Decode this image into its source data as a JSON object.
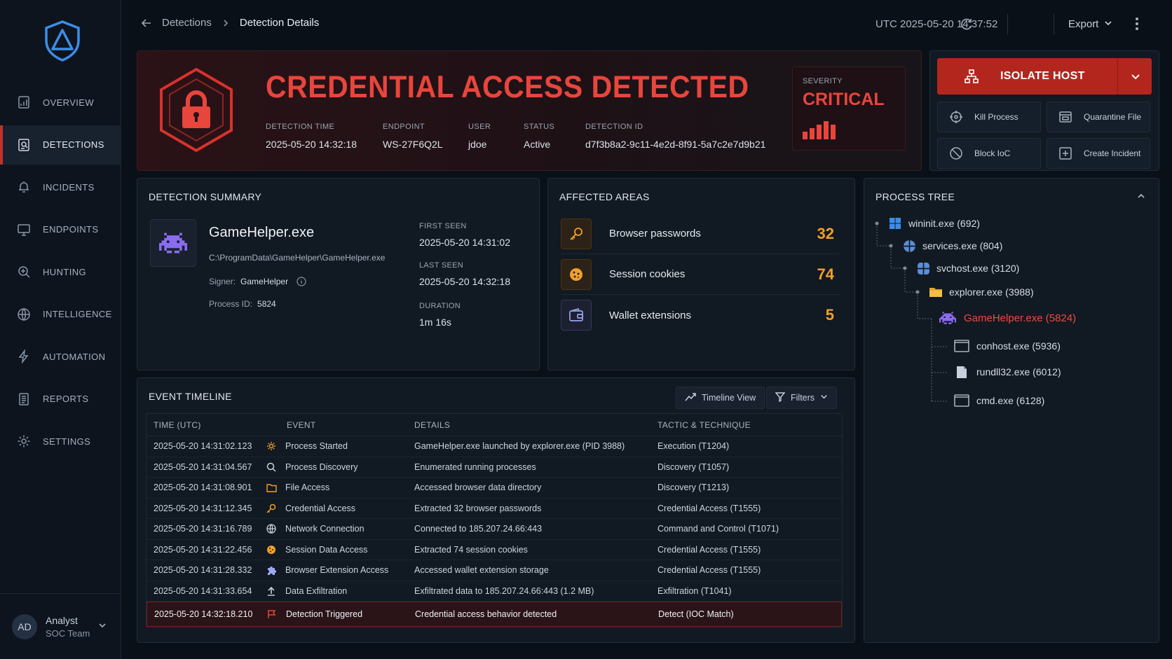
{
  "nav": {
    "items": [
      {
        "label": "OVERVIEW",
        "icon": "overview-icon"
      },
      {
        "label": "DETECTIONS",
        "icon": "detections-icon",
        "active": true
      },
      {
        "label": "INCIDENTS",
        "icon": "incidents-icon"
      },
      {
        "label": "ENDPOINTS",
        "icon": "endpoints-icon"
      },
      {
        "label": "HUNTING",
        "icon": "hunting-icon"
      },
      {
        "label": "INTELLIGENCE",
        "icon": "globe-icon"
      },
      {
        "label": "AUTOMATION",
        "icon": "automation-icon"
      },
      {
        "label": "REPORTS",
        "icon": "reports-icon"
      },
      {
        "label": "SETTINGS",
        "icon": "settings-icon"
      }
    ]
  },
  "user": {
    "initials": "AD",
    "name": "Analyst",
    "team": "SOC Team"
  },
  "topbar": {
    "breadcrumb_parent": "Detections",
    "breadcrumb_current": "Detection Details",
    "utc": "UTC 2025-05-20 14:37:52",
    "export_label": "Export"
  },
  "alert": {
    "title": "CREDENTIAL ACCESS DETECTED",
    "meta": [
      {
        "label": "DETECTION TIME",
        "value": "2025-05-20 14:32:18"
      },
      {
        "label": "ENDPOINT",
        "value": "WS-27F6Q2L"
      },
      {
        "label": "USER",
        "value": "jdoe"
      },
      {
        "label": "STATUS",
        "value": "Active"
      },
      {
        "label": "DETECTION ID",
        "value": "d7f3b8a2-9c11-4e2d-8f91-5a7c2e7d9b21"
      }
    ],
    "severity_label": "SEVERITY",
    "severity_value": "CRITICAL",
    "accent": "#e8453c"
  },
  "actions": {
    "isolate_label": "ISOLATE HOST",
    "buttons": [
      {
        "label": "Kill Process",
        "icon": "crosshair-icon"
      },
      {
        "label": "Quarantine File",
        "icon": "quarantine-icon"
      },
      {
        "label": "Block IoC",
        "icon": "block-icon"
      },
      {
        "label": "Create Incident",
        "icon": "plus-square-icon"
      }
    ]
  },
  "summary": {
    "title": "DETECTION SUMMARY",
    "app_name": "GameHelper.exe",
    "app_path": "C:\\ProgramData\\GameHelper\\GameHelper.exe",
    "signer_label": "Signer:",
    "signer_value": "GameHelper",
    "pid_label": "Process ID:",
    "pid_value": "5824",
    "first_seen_label": "FIRST SEEN",
    "first_seen": "2025-05-20 14:31:02",
    "last_seen_label": "LAST SEEN",
    "last_seen": "2025-05-20 14:32:18",
    "duration_label": "DURATION",
    "duration": "1m 16s"
  },
  "affected": {
    "title": "AFFECTED AREAS",
    "rows": [
      {
        "label": "Browser passwords",
        "count": "32",
        "icon": "key-icon"
      },
      {
        "label": "Session cookies",
        "count": "74",
        "icon": "cookie-icon"
      },
      {
        "label": "Wallet extensions",
        "count": "5",
        "icon": "wallet-icon"
      }
    ]
  },
  "tree": {
    "title": "PROCESS TREE",
    "nodes": [
      {
        "label": "wininit.exe (692)",
        "icon": "windows-icon"
      },
      {
        "label": "services.exe (804)",
        "icon": "services-icon"
      },
      {
        "label": "svchost.exe (3120)",
        "icon": "svchost-icon"
      },
      {
        "label": "explorer.exe (3988)",
        "icon": "folder-icon"
      },
      {
        "label": "GameHelper.exe (5824)",
        "icon": "invader-icon"
      },
      {
        "label": "conhost.exe (5936)",
        "icon": "console-icon"
      },
      {
        "label": "rundll32.exe (6012)",
        "icon": "file-icon"
      },
      {
        "label": "cmd.exe (6128)",
        "icon": "console-icon"
      }
    ]
  },
  "timeline": {
    "title": "EVENT TIMELINE",
    "view_label": "Timeline View",
    "filters_label": "Filters",
    "columns": [
      "TIME (UTC)",
      "EVENT",
      "DETAILS",
      "TACTIC & TECHNIQUE"
    ],
    "rows": [
      {
        "time": "2025-05-20 14:31:02.123",
        "event": "Process Started",
        "details": "GameHelper.exe launched by explorer.exe (PID 3988)",
        "tactic": "Execution (T1204)",
        "icon": "gear-icon"
      },
      {
        "time": "2025-05-20 14:31:04.567",
        "event": "Process Discovery",
        "details": "Enumerated running processes",
        "tactic": "Discovery (T1057)",
        "icon": "search-icon"
      },
      {
        "time": "2025-05-20 14:31:08.901",
        "event": "File Access",
        "details": "Accessed browser data directory",
        "tactic": "Discovery (T1213)",
        "icon": "folder-icon"
      },
      {
        "time": "2025-05-20 14:31:12.345",
        "event": "Credential Access",
        "details": "Extracted 32 browser passwords",
        "tactic": "Credential Access (T1555)",
        "icon": "key-icon"
      },
      {
        "time": "2025-05-20 14:31:16.789",
        "event": "Network Connection",
        "details": "Connected to 185.207.24.66:443",
        "tactic": "Command and Control (T1071)",
        "icon": "globe-icon"
      },
      {
        "time": "2025-05-20 14:31:22.456",
        "event": "Session Data Access",
        "details": "Extracted 74 session cookies",
        "tactic": "Credential Access (T1555)",
        "icon": "cookie-icon"
      },
      {
        "time": "2025-05-20 14:31:28.332",
        "event": "Browser Extension Access",
        "details": "Accessed wallet extension storage",
        "tactic": "Credential Access (T1555)",
        "icon": "puzzle-icon"
      },
      {
        "time": "2025-05-20 14:31:33.654",
        "event": "Data Exfiltration",
        "details": "Exfiltrated data to 185.207.24.66:443 (1.2 MB)",
        "tactic": "Exfiltration (T1041)",
        "icon": "upload-icon"
      },
      {
        "time": "2025-05-20 14:32:18.210",
        "event": "Detection Triggered",
        "details": "Credential access behavior detected",
        "tactic": "Detect (IOC Match)",
        "icon": "flag-icon",
        "highlight": true
      }
    ]
  }
}
